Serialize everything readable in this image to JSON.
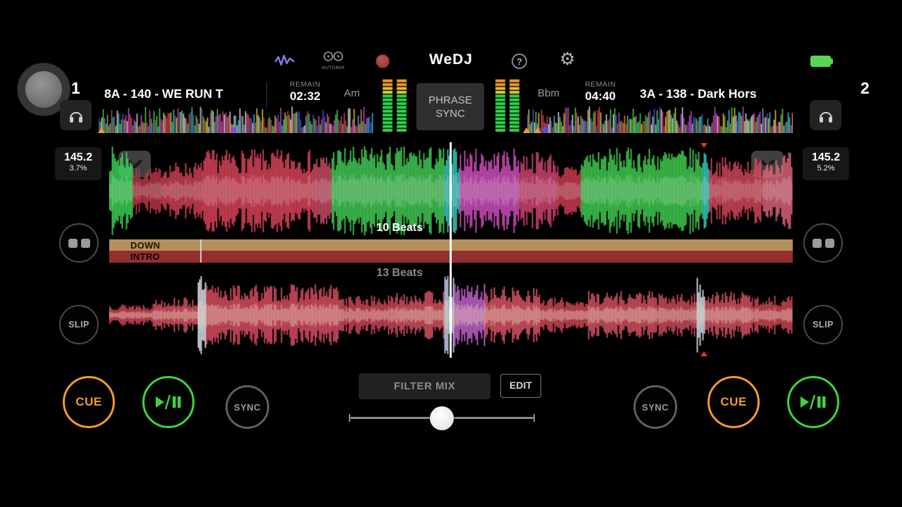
{
  "app": {
    "title": "WeDJ",
    "automix_label": "AUTOMIX",
    "help_label": "?"
  },
  "deck1": {
    "number": "1",
    "title": "8A - 140 - WE RUN T",
    "remain_label": "REMAIN",
    "remain_time": "02:32",
    "key": "Am",
    "bpm": "145.2",
    "pitch": "3.7%",
    "beats": "10 Beats"
  },
  "deck2": {
    "number": "2",
    "title": "3A - 138 - Dark Hors",
    "remain_label": "REMAIN",
    "remain_time": "04:40",
    "key": "Bbm",
    "bpm": "145.2",
    "pitch": "5.2%",
    "beats": "13 Beats"
  },
  "phrase": {
    "sync_line1": "PHRASE",
    "sync_line2": "SYNC",
    "down": "DOWN",
    "intro": "INTRO"
  },
  "controls": {
    "cue": "CUE",
    "sync": "SYNC",
    "slip": "SLIP",
    "filter_mix": "FILTER MIX",
    "edit": "EDIT"
  },
  "colors": {
    "cue_orange": "#ef9b2d",
    "play_green": "#3fd43f",
    "meter_green": "#2ed84a",
    "meter_yellow": "#e8c42e",
    "phrase_down_bar": "#b5905a",
    "phrase_intro_bar": "#942f2f",
    "battery_green": "#56d656",
    "wave_icon_purple": "#8a7ae8"
  }
}
